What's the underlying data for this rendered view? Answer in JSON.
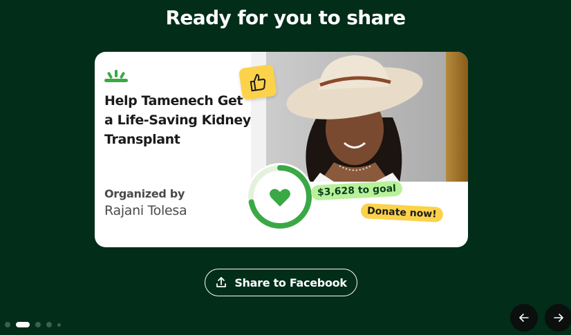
{
  "page": {
    "title": "Ready for you to share",
    "background_color": "#012d19"
  },
  "card": {
    "logo_icon": "gofundme-sprout-icon",
    "campaign_title": "Help Tamenech Get a Life-Saving Kidney Transplant",
    "organized_by_label": "Organized by",
    "organizer_name": "Rajani Tolesa",
    "thumb_icon": "thumbs-up-icon",
    "progress_icon": "heart-icon",
    "progress_fraction": 0.72,
    "goal_badge": "$3,628 to goal",
    "donate_badge": "Donate now!",
    "accent_green": "#3aa845",
    "badge_green": "#b9f19a",
    "badge_yellow": "#fbd24a"
  },
  "share": {
    "icon": "upload-icon",
    "label": "Share to Facebook"
  },
  "carousel": {
    "dots": [
      "dot-1",
      "dot-2",
      "dot-3",
      "dot-4",
      "dot-5"
    ],
    "active_index": 1,
    "prev_icon": "arrow-left-icon",
    "next_icon": "arrow-right-icon"
  }
}
